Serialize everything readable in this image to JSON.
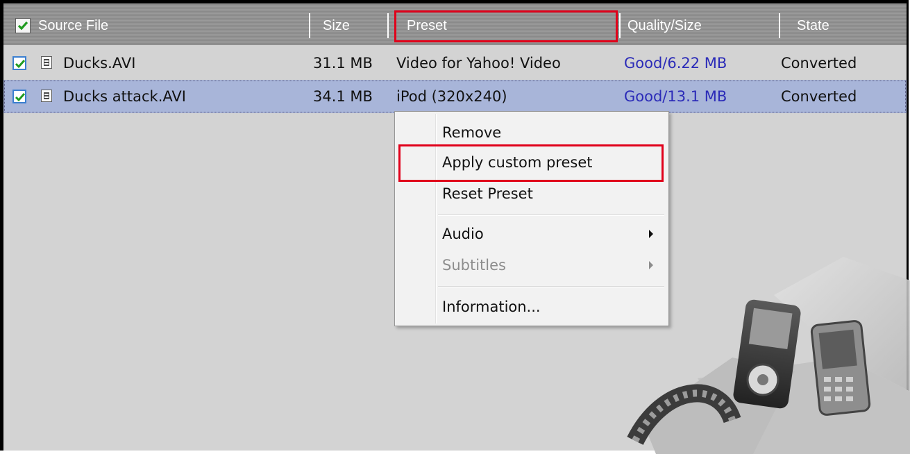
{
  "header": {
    "select_all_checked": true,
    "columns": [
      "Source File",
      "Size",
      "Preset",
      "Quality/Size",
      "State"
    ]
  },
  "rows": [
    {
      "checked": true,
      "file": "Ducks.AVI",
      "size": "31.1 MB",
      "preset": "Video for Yahoo! Video",
      "quality": "Good/6.22 MB",
      "state": "Converted",
      "selected": false
    },
    {
      "checked": true,
      "file": "Ducks attack.AVI",
      "size": "34.1 MB",
      "preset": "iPod (320x240)",
      "quality": "Good/13.1 MB",
      "state": "Converted",
      "selected": true
    }
  ],
  "context_menu": {
    "items": [
      {
        "label": "Remove",
        "enabled": true
      },
      {
        "label": "Apply custom preset",
        "enabled": true,
        "highlighted": true
      },
      {
        "label": "Reset Preset",
        "enabled": true
      },
      {
        "label": "Audio",
        "enabled": true,
        "submenu": true
      },
      {
        "label": "Subtitles",
        "enabled": false,
        "submenu": true
      },
      {
        "label": "Information...",
        "enabled": true
      }
    ]
  },
  "colors": {
    "highlight_box": "#e0001a",
    "selected_row": "#a8b5d9",
    "quality_text": "#2b2bb8",
    "header_bg": "#939393"
  },
  "icons": [
    "checkbox-checked-icon",
    "video-file-icon",
    "submenu-arrow-icon",
    "devices-box-illustration"
  ]
}
